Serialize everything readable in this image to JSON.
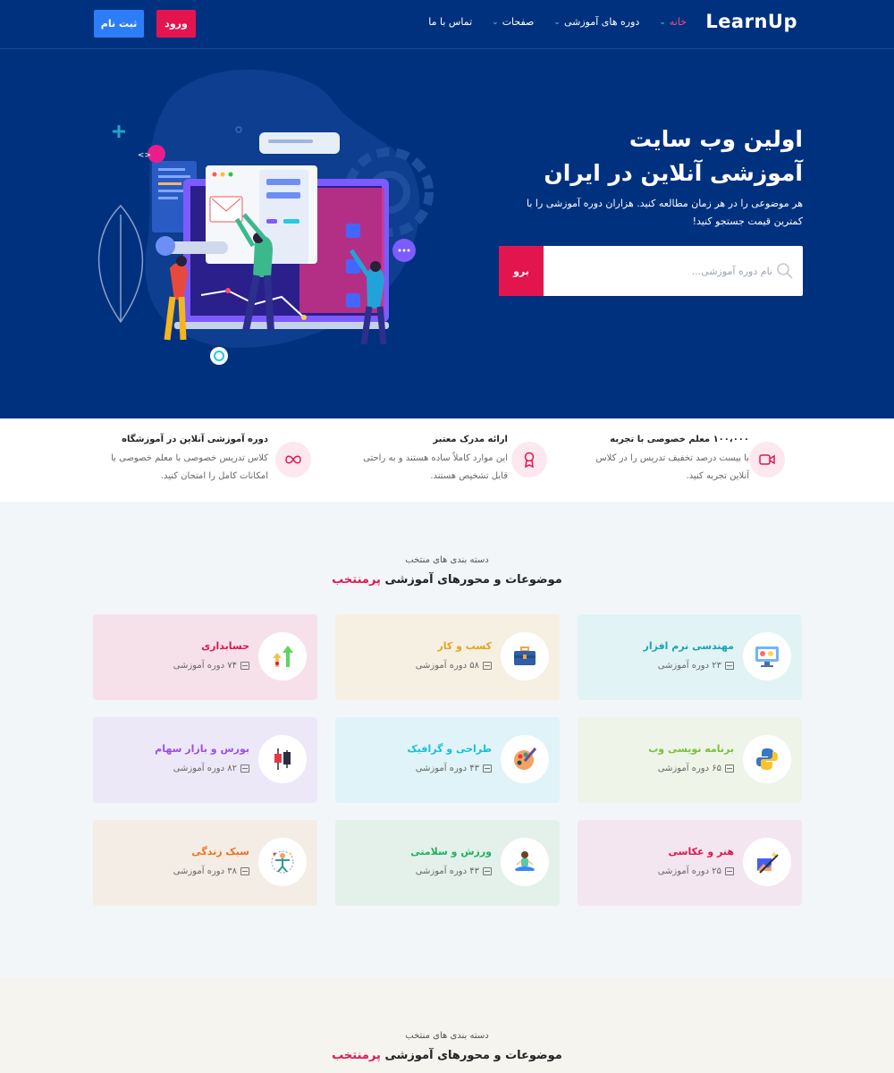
{
  "header": {
    "logo": "LearnUp",
    "nav": [
      {
        "label": "خانه",
        "dropdown": true,
        "active": true
      },
      {
        "label": "دوره های آموزشی",
        "dropdown": true
      },
      {
        "label": "صفحات",
        "dropdown": true
      },
      {
        "label": "تماس با ما",
        "dropdown": false
      }
    ],
    "login_label": "ورود",
    "register_label": "ثبت نام"
  },
  "hero": {
    "title_line1": "اولین وب سایت",
    "title_line2": "آموزشی آنلاین در ایران",
    "subtitle": "هر موضوعی را در هر زمان مطالعه کنید. هزاران دوره آموزشی را با کمترین قیمت جستجو کنید!",
    "search_placeholder": "نام دوره آموزشی...",
    "search_button": "برو"
  },
  "features": [
    {
      "title": "۱۰۰،۰۰۰ معلم خصوصی با تجربه",
      "text": "با بیست درصد تخفیف تدریس را در کلاس آنلاین تجربه کنید.",
      "icon": "video-camera-icon"
    },
    {
      "title": "ارائه مدرک معتبر",
      "text": "این موارد کاملاً ساده هستند و به راحتی قابل تشخیص هستند.",
      "icon": "certificate-icon"
    },
    {
      "title": "دوره آموزشی آنلاین در آموزشگاه",
      "text": "کلاس تدریس خصوصی با معلم خصوصی با امکانات کامل را امتحان کنید.",
      "icon": "infinity-icon"
    }
  ],
  "categories_section": {
    "subtitle": "دسته بندی های منتخب",
    "title_main": "موضوعات و محورهای آموزشی",
    "title_highlight": "پرمنتخب",
    "items": [
      {
        "title": "مهندسی نرم افزار",
        "count": "۲۳ دوره آموزشی",
        "color": "#1aa3b8",
        "bg": "#e1f3f4",
        "icon": "monitor-icon"
      },
      {
        "title": "کسب و کار",
        "count": "۵۸ دوره آموزشی",
        "color": "#e8a317",
        "bg": "#f5f0e2",
        "icon": "briefcase-icon"
      },
      {
        "title": "حسابداری",
        "count": "۷۴ دوره آموزشی",
        "color": "#e3154f",
        "bg": "#f6e1ea",
        "icon": "growth-arrows-icon"
      },
      {
        "title": "برنامه نویسی وب",
        "count": "۶۵ دوره آموزشی",
        "color": "#7ac143",
        "bg": "#eef5e8",
        "icon": "python-icon"
      },
      {
        "title": "طراحی و گرافیک",
        "count": "۴۳ دوره آموزشی",
        "color": "#17c1d6",
        "bg": "#dff3f8",
        "icon": "palette-icon"
      },
      {
        "title": "بورس و بازار سهام",
        "count": "۸۲ دوره آموزشی",
        "color": "#9b51e0",
        "bg": "#ece8f8",
        "icon": "candlestick-icon"
      },
      {
        "title": "هنر و عکاسی",
        "count": "۲۵ دوره آموزشی",
        "color": "#e3154f",
        "bg": "#f4e6f0",
        "icon": "magic-picture-icon"
      },
      {
        "title": "ورزش و سلامتی",
        "count": "۴۳ دوره آموزشی",
        "color": "#27ae60",
        "bg": "#e3f1ea",
        "icon": "yoga-icon"
      },
      {
        "title": "سبک زندگی",
        "count": "۳۸ دوره آموزشی",
        "color": "#f2711c",
        "bg": "#f4ede5",
        "icon": "vitruvian-icon"
      }
    ]
  },
  "second_section": {
    "subtitle": "دسته بندی های منتخب",
    "title_main": "موضوعات و محورهای آموزشی",
    "title_highlight": "پرمنتخب"
  }
}
